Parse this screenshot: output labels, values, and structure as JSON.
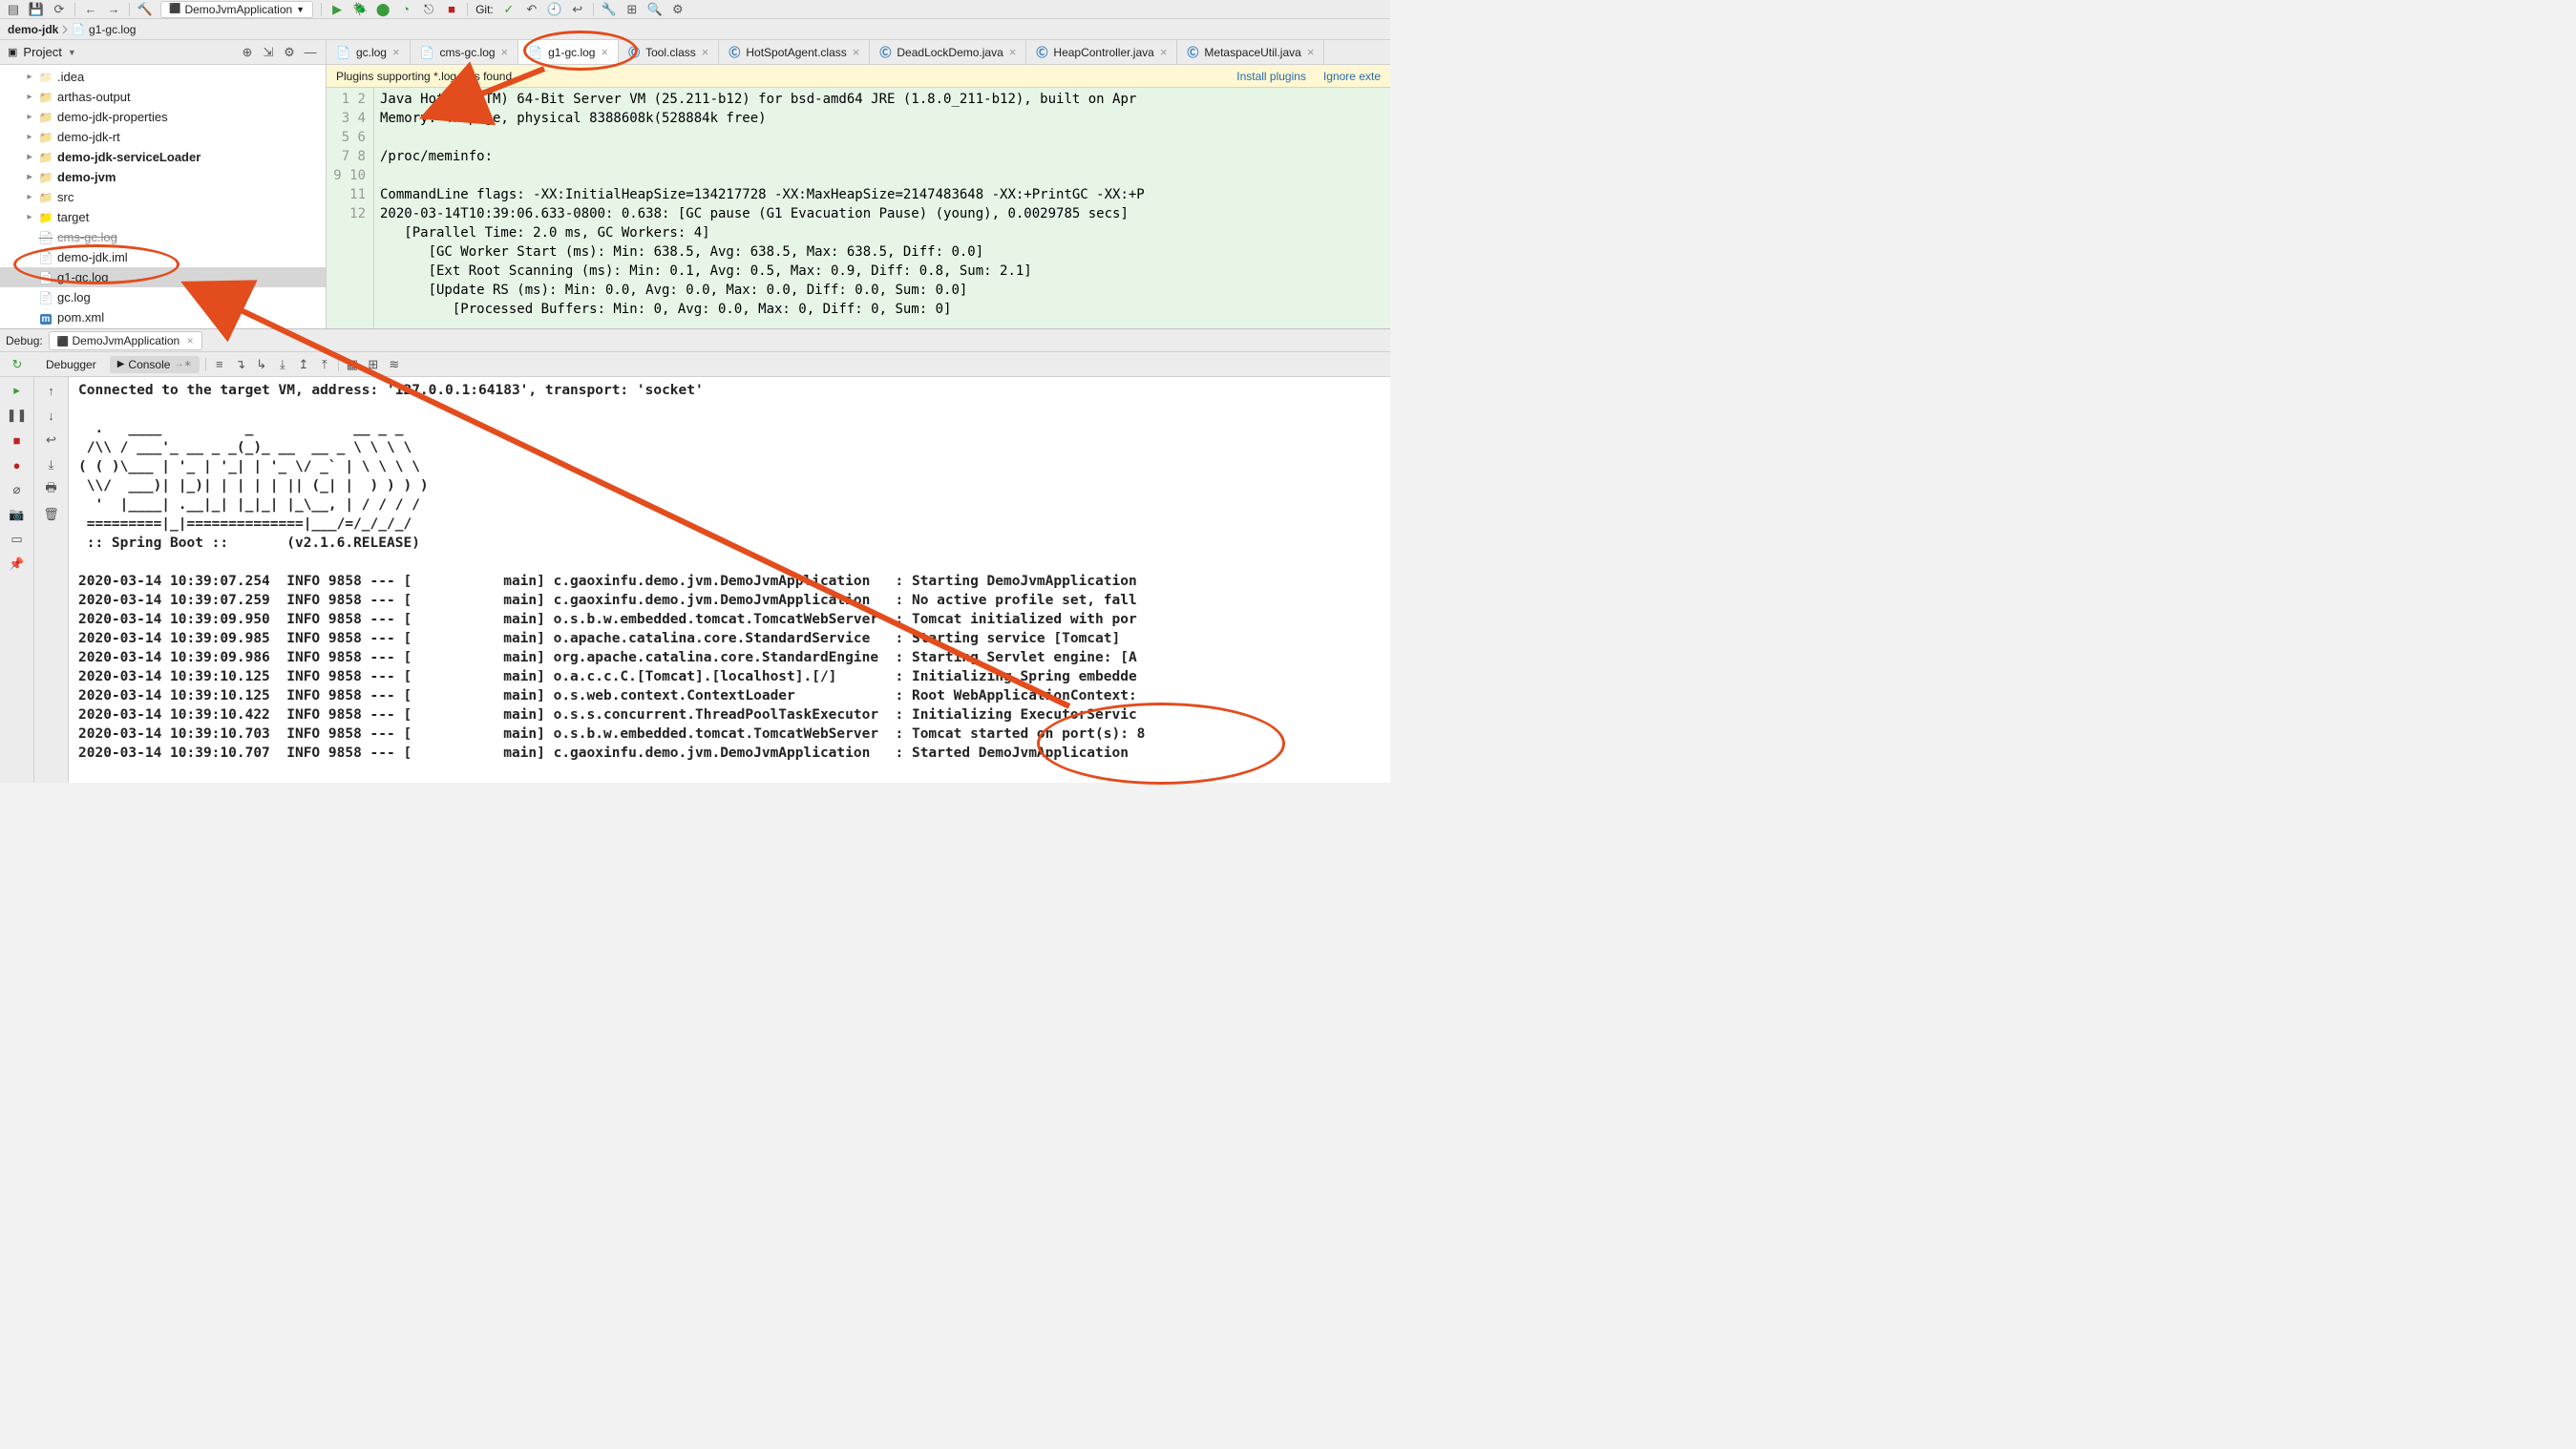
{
  "toolbar": {
    "run_config": "DemoJvmApplication",
    "git_label": "Git:"
  },
  "crumbs": {
    "project": "demo-jdk",
    "file": "g1-gc.log"
  },
  "sidebar": {
    "title": "Project",
    "items": [
      {
        "label": ".idea",
        "kind": "folder",
        "expand": false,
        "depth": 1,
        "grey": true
      },
      {
        "label": "arthas-output",
        "kind": "folder",
        "expand": false,
        "depth": 1
      },
      {
        "label": "demo-jdk-properties",
        "kind": "folder",
        "expand": true,
        "depth": 1
      },
      {
        "label": "demo-jdk-rt",
        "kind": "folder",
        "expand": true,
        "depth": 1
      },
      {
        "label": "demo-jdk-serviceLoader",
        "kind": "folder",
        "expand": true,
        "depth": 1,
        "bold": true
      },
      {
        "label": "demo-jvm",
        "kind": "folder",
        "expand": true,
        "depth": 1,
        "bold": true
      },
      {
        "label": "src",
        "kind": "folder",
        "expand": true,
        "depth": 1
      },
      {
        "label": "target",
        "kind": "folder",
        "expand": true,
        "depth": 1,
        "orange": true
      },
      {
        "label": "cms-gc.log",
        "kind": "file",
        "depth": 1,
        "struck": true
      },
      {
        "label": "demo-jdk.iml",
        "kind": "file",
        "depth": 1
      },
      {
        "label": "g1-gc.log",
        "kind": "file",
        "depth": 1,
        "selected": true
      },
      {
        "label": "gc.log",
        "kind": "file",
        "depth": 1
      },
      {
        "label": "pom.xml",
        "kind": "pom",
        "depth": 1
      }
    ]
  },
  "editor": {
    "tabs": [
      {
        "label": "gc.log",
        "icon": "log"
      },
      {
        "label": "cms-gc.log",
        "icon": "log"
      },
      {
        "label": "g1-gc.log",
        "icon": "log",
        "active": true
      },
      {
        "label": "Tool.class",
        "icon": "c"
      },
      {
        "label": "HotSpotAgent.class",
        "icon": "c"
      },
      {
        "label": "DeadLockDemo.java",
        "icon": "c"
      },
      {
        "label": "HeapController.java",
        "icon": "c"
      },
      {
        "label": "MetaspaceUtil.java",
        "icon": "c"
      }
    ],
    "banner": {
      "msg": "Plugins supporting *.log files found",
      "link1": "Install plugins",
      "link2": "Ignore exte"
    },
    "lines": [
      "Java HotSpot(TM) 64-Bit Server VM (25.211-b12) for bsd-amd64 JRE (1.8.0_211-b12), built on Apr",
      "Memory: 4k page, physical 8388608k(528884k free)",
      "",
      "/proc/meminfo:",
      "",
      "CommandLine flags: -XX:InitialHeapSize=134217728 -XX:MaxHeapSize=2147483648 -XX:+PrintGC -XX:+P",
      "2020-03-14T10:39:06.633-0800: 0.638: [GC pause (G1 Evacuation Pause) (young), 0.0029785 secs]",
      "   [Parallel Time: 2.0 ms, GC Workers: 4]",
      "      [GC Worker Start (ms): Min: 638.5, Avg: 638.5, Max: 638.5, Diff: 0.0]",
      "      [Ext Root Scanning (ms): Min: 0.1, Avg: 0.5, Max: 0.9, Diff: 0.8, Sum: 2.1]",
      "      [Update RS (ms): Min: 0.0, Avg: 0.0, Max: 0.0, Diff: 0.0, Sum: 0.0]",
      "         [Processed Buffers: Min: 0, Avg: 0.0, Max: 0, Diff: 0, Sum: 0]"
    ]
  },
  "debug": {
    "label": "Debug:",
    "run_tab": "DemoJvmApplication",
    "subtabs": {
      "debugger": "Debugger",
      "console": "Console"
    },
    "console_lines": [
      "Connected to the target VM, address: '127.0.0.1:64183', transport: 'socket'",
      "",
      "  .   ____          _            __ _ _",
      " /\\\\ / ___'_ __ _ _(_)_ __  __ _ \\ \\ \\ \\",
      "( ( )\\___ | '_ | '_| | '_ \\/ _` | \\ \\ \\ \\",
      " \\\\/  ___)| |_)| | | | | || (_| |  ) ) ) )",
      "  '  |____| .__|_| |_|_| |_\\__, | / / / /",
      " =========|_|==============|___/=/_/_/_/",
      " :: Spring Boot ::       (v2.1.6.RELEASE)",
      "",
      "2020-03-14 10:39:07.254  INFO 9858 --- [           main] c.gaoxinfu.demo.jvm.DemoJvmApplication   : Starting DemoJvmApplication",
      "2020-03-14 10:39:07.259  INFO 9858 --- [           main] c.gaoxinfu.demo.jvm.DemoJvmApplication   : No active profile set, fall",
      "2020-03-14 10:39:09.950  INFO 9858 --- [           main] o.s.b.w.embedded.tomcat.TomcatWebServer  : Tomcat initialized with por",
      "2020-03-14 10:39:09.985  INFO 9858 --- [           main] o.apache.catalina.core.StandardService   : Starting service [Tomcat]",
      "2020-03-14 10:39:09.986  INFO 9858 --- [           main] org.apache.catalina.core.StandardEngine  : Starting Servlet engine: [A",
      "2020-03-14 10:39:10.125  INFO 9858 --- [           main] o.a.c.c.C.[Tomcat].[localhost].[/]       : Initializing Spring embedde",
      "2020-03-14 10:39:10.125  INFO 9858 --- [           main] o.s.web.context.ContextLoader            : Root WebApplicationContext:",
      "2020-03-14 10:39:10.422  INFO 9858 --- [           main] o.s.s.concurrent.ThreadPoolTaskExecutor  : Initializing ExecutorServic",
      "2020-03-14 10:39:10.703  INFO 9858 --- [           main] o.s.b.w.embedded.tomcat.TomcatWebServer  : Tomcat started on port(s): 8",
      "2020-03-14 10:39:10.707  INFO 9858 --- [           main] c.gaoxinfu.demo.jvm.DemoJvmApplication   : Started DemoJvmApplication "
    ]
  },
  "gutter_start": 1,
  "gutter_end": 12
}
